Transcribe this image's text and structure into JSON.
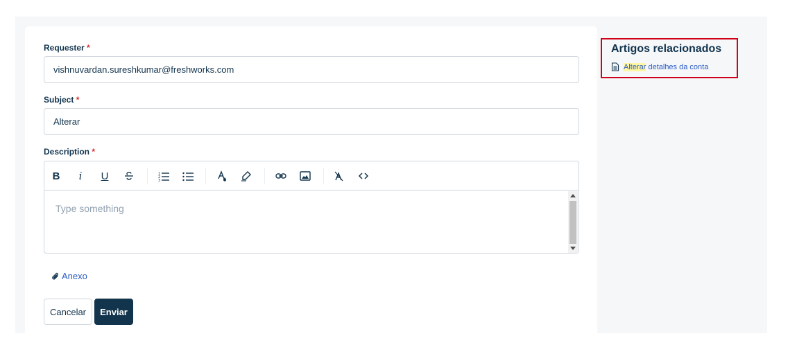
{
  "form": {
    "requester_label": "Requester",
    "requester_value": "vishnuvardan.sureshkumar@freshworks.com",
    "subject_label": "Subject",
    "subject_value": "Alterar",
    "description_label": "Description",
    "required_marker": "*",
    "description_placeholder": "Type something",
    "attachment_label": "Anexo",
    "cancel_label": "Cancelar",
    "submit_label": "Enviar"
  },
  "toolbar": {
    "bold": "B",
    "italic": "i",
    "underline": "U",
    "icons": [
      "strikethrough-icon",
      "ordered-list-icon",
      "bullet-list-icon",
      "font-color-icon",
      "highlight-icon",
      "link-icon",
      "image-icon",
      "clear-format-icon",
      "code-icon"
    ]
  },
  "sidebar": {
    "title": "Artigos relacionados",
    "articles": [
      {
        "highlight": "Alterar",
        "rest": " detalhes da conta"
      }
    ]
  },
  "colors": {
    "primary": "#12344d",
    "link": "#2c5cc5",
    "required": "#d72d30",
    "highlight_box": "#d0021b",
    "highlight_text": "#fff7a1"
  }
}
